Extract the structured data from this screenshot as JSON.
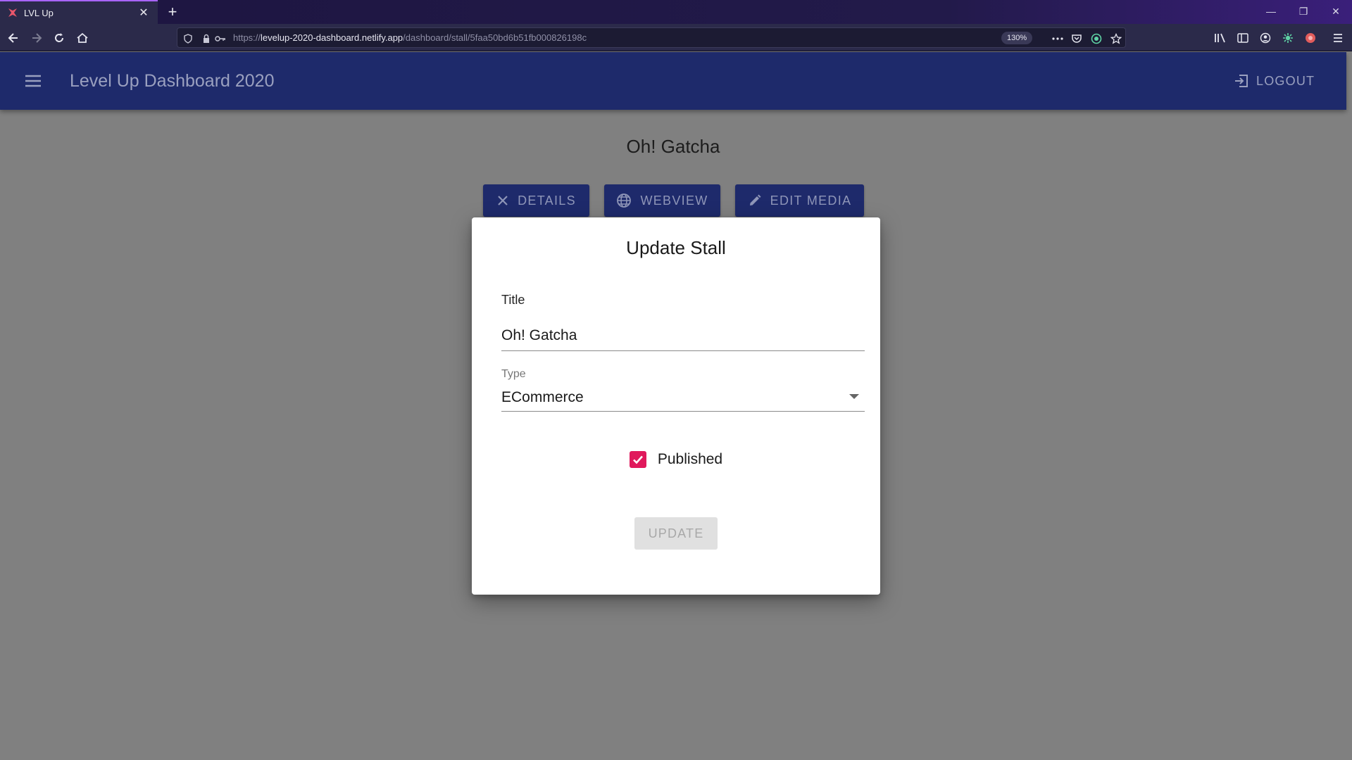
{
  "browser": {
    "tab_title": "LVL Up",
    "url_prefix": "https://",
    "url_host": "levelup-2020-dashboard.netlify.app",
    "url_path": "/dashboard/stall/5faa50bd6b51fb000826198c",
    "zoom": "130%",
    "icons": [
      "back-icon",
      "forward-icon",
      "reload-icon",
      "home-icon",
      "shield-icon",
      "lock-icon",
      "key-icon",
      "more-icon",
      "pocket-icon",
      "extension-icon",
      "star-icon",
      "library-icon",
      "sidebar-icon",
      "account-icon",
      "extension-icon",
      "extension-icon",
      "menu-icon"
    ]
  },
  "appbar": {
    "title": "Level Up Dashboard 2020",
    "logout_label": "LOGOUT"
  },
  "page": {
    "title": "Oh! Gatcha",
    "buttons": {
      "details": "DETAILS",
      "webview": "WEBVIEW",
      "edit_media": "EDIT MEDIA"
    }
  },
  "dialog": {
    "title": "Update Stall",
    "title_label": "Title",
    "title_value": "Oh! Gatcha",
    "type_label": "Type",
    "type_value": "ECommerce",
    "published_label": "Published",
    "published_checked": true,
    "update_label": "UPDATE"
  },
  "colors": {
    "appbar": "#1e2a6b",
    "overlay": "#808080",
    "checkbox": "#e0195c",
    "browser_chrome": "#2b2a4a"
  }
}
